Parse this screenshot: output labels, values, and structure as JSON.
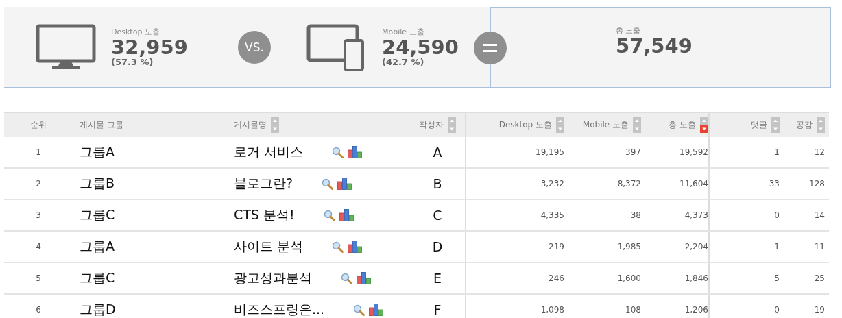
{
  "summary": {
    "desktop": {
      "label": "Desktop 노출",
      "value": "32,959",
      "share": "(57.3 %)"
    },
    "vs": "VS.",
    "mobile": {
      "label": "Mobile 노출",
      "value": "24,590",
      "share": "(42.7 %)"
    },
    "total": {
      "label": "총 노출",
      "value": "57,549"
    }
  },
  "table": {
    "columns": [
      {
        "label": "순위"
      },
      {
        "label": "게시물 그룹"
      },
      {
        "label": "게시물명",
        "sorted_desc": false
      },
      {
        "label": "작성자",
        "sorted_desc": false
      },
      {
        "label": "Desktop 노출",
        "sorted_desc": false
      },
      {
        "label": "Mobile 노출",
        "sorted_desc": false
      },
      {
        "label": "총 노출",
        "sorted_desc": true
      },
      {
        "label": "댓글",
        "sorted_desc": false
      },
      {
        "label": "공감",
        "sorted_desc": false
      }
    ],
    "rows": [
      {
        "rank": "1",
        "group": "그룹A",
        "title": "로거 서비스",
        "author": "A",
        "desktop": "19,195",
        "mobile": "397",
        "total": "19,592",
        "comments": "1",
        "likes": "12"
      },
      {
        "rank": "2",
        "group": "그룹B",
        "title": "블로그란?",
        "author": "B",
        "desktop": "3,232",
        "mobile": "8,372",
        "total": "11,604",
        "comments": "33",
        "likes": "128"
      },
      {
        "rank": "3",
        "group": "그룹C",
        "title": "CTS 분석!",
        "author": "C",
        "desktop": "4,335",
        "mobile": "38",
        "total": "4,373",
        "comments": "0",
        "likes": "14"
      },
      {
        "rank": "4",
        "group": "그룹A",
        "title": "사이트 분석",
        "author": "D",
        "desktop": "219",
        "mobile": "1,985",
        "total": "2,204",
        "comments": "1",
        "likes": "11"
      },
      {
        "rank": "5",
        "group": "그룹C",
        "title": "광고성과분석",
        "author": "E",
        "desktop": "246",
        "mobile": "1,600",
        "total": "1,846",
        "comments": "5",
        "likes": "25"
      },
      {
        "rank": "6",
        "group": "그룹D",
        "title": "비즈스프링은...",
        "author": "F",
        "desktop": "1,098",
        "mobile": "108",
        "total": "1,206",
        "comments": "0",
        "likes": "19"
      }
    ]
  }
}
